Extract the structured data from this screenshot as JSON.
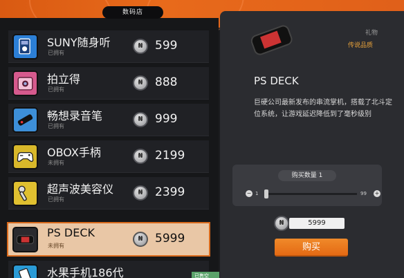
{
  "shop": {
    "title": "数码店"
  },
  "items": [
    {
      "name": "SUNY随身听",
      "status": "已拥有",
      "price": "599",
      "icon": "walkman-icon",
      "color": "#2c7fd6"
    },
    {
      "name": "拍立得",
      "status": "已拥有",
      "price": "888",
      "icon": "instant-camera-icon",
      "color": "#d65a8d"
    },
    {
      "name": "畅想录音笔",
      "status": "已拥有",
      "price": "999",
      "icon": "voice-recorder-icon",
      "color": "#3d8fd8"
    },
    {
      "name": "OBOX手柄",
      "status": "未拥有",
      "price": "2199",
      "icon": "gamepad-icon",
      "color": "#d9b82a"
    },
    {
      "name": "超声波美容仪",
      "status": "已拥有",
      "price": "2399",
      "icon": "beauty-device-icon",
      "color": "#e0c030"
    },
    {
      "name": "PS DECK",
      "status": "未拥有",
      "price": "5999",
      "icon": "handheld-console-icon",
      "color": "#2a2a2e",
      "selected": true
    },
    {
      "name": "水果手机186代",
      "status": "",
      "price": "",
      "icon": "phone-icon",
      "color": "#2a9bd6"
    }
  ],
  "badge": {
    "label": "已售空"
  },
  "detail": {
    "category": "礼物",
    "rarity": "传说品质",
    "title": "PS DECK",
    "description": "巨硬公司最新发布的串流掌机，搭载了北斗定位系统，让游戏延迟降低到了毫秒级别",
    "qty_label": "购买数量 1",
    "range_min": "1",
    "range_max": "99",
    "quantity_fraction": 0.0,
    "total": "5999",
    "buy_label": "购买"
  },
  "colors": {
    "accent": "#e46a14",
    "rarity": "#e8a23a",
    "selected_bg": "#e9c7a6"
  }
}
